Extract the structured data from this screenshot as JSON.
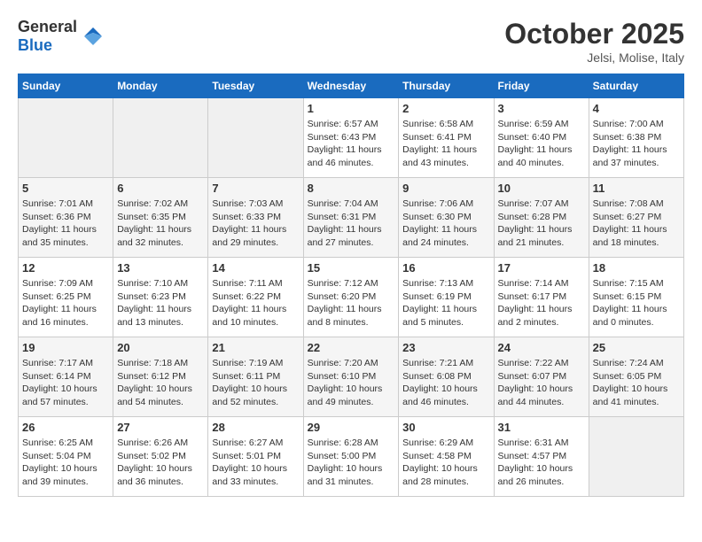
{
  "header": {
    "logo_general": "General",
    "logo_blue": "Blue",
    "month": "October 2025",
    "location": "Jelsi, Molise, Italy"
  },
  "days_of_week": [
    "Sunday",
    "Monday",
    "Tuesday",
    "Wednesday",
    "Thursday",
    "Friday",
    "Saturday"
  ],
  "weeks": [
    [
      {
        "num": "",
        "empty": true
      },
      {
        "num": "",
        "empty": true
      },
      {
        "num": "",
        "empty": true
      },
      {
        "num": "1",
        "sunrise": "6:57 AM",
        "sunset": "6:43 PM",
        "daylight": "11 hours and 46 minutes."
      },
      {
        "num": "2",
        "sunrise": "6:58 AM",
        "sunset": "6:41 PM",
        "daylight": "11 hours and 43 minutes."
      },
      {
        "num": "3",
        "sunrise": "6:59 AM",
        "sunset": "6:40 PM",
        "daylight": "11 hours and 40 minutes."
      },
      {
        "num": "4",
        "sunrise": "7:00 AM",
        "sunset": "6:38 PM",
        "daylight": "11 hours and 37 minutes."
      }
    ],
    [
      {
        "num": "5",
        "sunrise": "7:01 AM",
        "sunset": "6:36 PM",
        "daylight": "11 hours and 35 minutes."
      },
      {
        "num": "6",
        "sunrise": "7:02 AM",
        "sunset": "6:35 PM",
        "daylight": "11 hours and 32 minutes."
      },
      {
        "num": "7",
        "sunrise": "7:03 AM",
        "sunset": "6:33 PM",
        "daylight": "11 hours and 29 minutes."
      },
      {
        "num": "8",
        "sunrise": "7:04 AM",
        "sunset": "6:31 PM",
        "daylight": "11 hours and 27 minutes."
      },
      {
        "num": "9",
        "sunrise": "7:06 AM",
        "sunset": "6:30 PM",
        "daylight": "11 hours and 24 minutes."
      },
      {
        "num": "10",
        "sunrise": "7:07 AM",
        "sunset": "6:28 PM",
        "daylight": "11 hours and 21 minutes."
      },
      {
        "num": "11",
        "sunrise": "7:08 AM",
        "sunset": "6:27 PM",
        "daylight": "11 hours and 18 minutes."
      }
    ],
    [
      {
        "num": "12",
        "sunrise": "7:09 AM",
        "sunset": "6:25 PM",
        "daylight": "11 hours and 16 minutes."
      },
      {
        "num": "13",
        "sunrise": "7:10 AM",
        "sunset": "6:23 PM",
        "daylight": "11 hours and 13 minutes."
      },
      {
        "num": "14",
        "sunrise": "7:11 AM",
        "sunset": "6:22 PM",
        "daylight": "11 hours and 10 minutes."
      },
      {
        "num": "15",
        "sunrise": "7:12 AM",
        "sunset": "6:20 PM",
        "daylight": "11 hours and 8 minutes."
      },
      {
        "num": "16",
        "sunrise": "7:13 AM",
        "sunset": "6:19 PM",
        "daylight": "11 hours and 5 minutes."
      },
      {
        "num": "17",
        "sunrise": "7:14 AM",
        "sunset": "6:17 PM",
        "daylight": "11 hours and 2 minutes."
      },
      {
        "num": "18",
        "sunrise": "7:15 AM",
        "sunset": "6:15 PM",
        "daylight": "11 hours and 0 minutes."
      }
    ],
    [
      {
        "num": "19",
        "sunrise": "7:17 AM",
        "sunset": "6:14 PM",
        "daylight": "10 hours and 57 minutes."
      },
      {
        "num": "20",
        "sunrise": "7:18 AM",
        "sunset": "6:12 PM",
        "daylight": "10 hours and 54 minutes."
      },
      {
        "num": "21",
        "sunrise": "7:19 AM",
        "sunset": "6:11 PM",
        "daylight": "10 hours and 52 minutes."
      },
      {
        "num": "22",
        "sunrise": "7:20 AM",
        "sunset": "6:10 PM",
        "daylight": "10 hours and 49 minutes."
      },
      {
        "num": "23",
        "sunrise": "7:21 AM",
        "sunset": "6:08 PM",
        "daylight": "10 hours and 46 minutes."
      },
      {
        "num": "24",
        "sunrise": "7:22 AM",
        "sunset": "6:07 PM",
        "daylight": "10 hours and 44 minutes."
      },
      {
        "num": "25",
        "sunrise": "7:24 AM",
        "sunset": "6:05 PM",
        "daylight": "10 hours and 41 minutes."
      }
    ],
    [
      {
        "num": "26",
        "sunrise": "6:25 AM",
        "sunset": "5:04 PM",
        "daylight": "10 hours and 39 minutes."
      },
      {
        "num": "27",
        "sunrise": "6:26 AM",
        "sunset": "5:02 PM",
        "daylight": "10 hours and 36 minutes."
      },
      {
        "num": "28",
        "sunrise": "6:27 AM",
        "sunset": "5:01 PM",
        "daylight": "10 hours and 33 minutes."
      },
      {
        "num": "29",
        "sunrise": "6:28 AM",
        "sunset": "5:00 PM",
        "daylight": "10 hours and 31 minutes."
      },
      {
        "num": "30",
        "sunrise": "6:29 AM",
        "sunset": "4:58 PM",
        "daylight": "10 hours and 28 minutes."
      },
      {
        "num": "31",
        "sunrise": "6:31 AM",
        "sunset": "4:57 PM",
        "daylight": "10 hours and 26 minutes."
      },
      {
        "num": "",
        "empty": true
      }
    ]
  ]
}
